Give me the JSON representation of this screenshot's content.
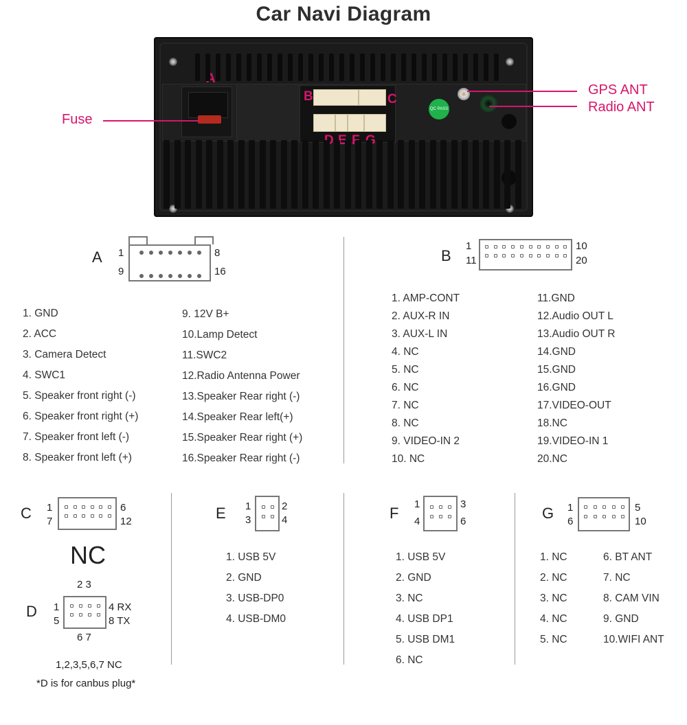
{
  "title": "Car Navi Diagram",
  "photo": {
    "connector_labels": [
      "A",
      "B",
      "C",
      "D",
      "E",
      "F",
      "G"
    ],
    "callouts": {
      "fuse": "Fuse",
      "gps_ant": "GPS ANT",
      "radio_ant": "Radio ANT"
    },
    "sticker": "QC PASS",
    "accent_color": "#d6156b"
  },
  "connector_a": {
    "letter": "A",
    "pin_labels": {
      "top_left": "1",
      "top_right": "8",
      "bottom_left": "9",
      "bottom_right": "16"
    },
    "pins_left": [
      "1. GND",
      "2. ACC",
      "3. Camera Detect",
      "4. SWC1",
      "5. Speaker front right (-)",
      "6. Speaker front right (+)",
      "7. Speaker front left (-)",
      "8. Speaker front left (+)"
    ],
    "pins_right": [
      "9.  12V B+",
      "10.Lamp Detect",
      "11.SWC2",
      "12.Radio Antenna Power",
      "13.Speaker Rear right (-)",
      "14.Speaker Rear left(+)",
      "15.Speaker Rear right (+)",
      "16.Speaker Rear right (-)"
    ]
  },
  "connector_b": {
    "letter": "B",
    "pin_labels": {
      "top_left": "1",
      "top_right": "10",
      "bottom_left": "11",
      "bottom_right": "20"
    },
    "pins_left": [
      "1.  AMP-CONT",
      "2.  AUX-R IN",
      "3.  AUX-L IN",
      "4.  NC",
      "5.  NC",
      "6.  NC",
      "7.  NC",
      "8.  NC",
      "9. VIDEO-IN 2",
      "10.  NC"
    ],
    "pins_right": [
      "11.GND",
      "12.Audio OUT  L",
      "13.Audio OUT  R",
      "14.GND",
      "15.GND",
      "16.GND",
      "17.VIDEO-OUT",
      "18.NC",
      "19.VIDEO-IN 1",
      "20.NC"
    ]
  },
  "connector_c": {
    "letter": "C",
    "pin_labels": {
      "top_left": "1",
      "top_right": "6",
      "bottom_left": "7",
      "bottom_right": "12"
    },
    "status": "NC"
  },
  "connector_d": {
    "letter": "D",
    "pin_labels": {
      "top": "2 3",
      "top_left": "1",
      "top_right": "4  RX",
      "bottom_left": "5",
      "bottom_right": "8  TX",
      "bottom": "6 7"
    },
    "nc_note": "1,2,3,5,6,7  NC",
    "footnote": "*D is for canbus plug*"
  },
  "connector_e": {
    "letter": "E",
    "pin_labels": {
      "top_left": "1",
      "top_right": "2",
      "bottom_left": "3",
      "bottom_right": "4"
    },
    "pins": [
      "1. USB 5V",
      "2. GND",
      "3. USB-DP0",
      "4. USB-DM0"
    ]
  },
  "connector_f": {
    "letter": "F",
    "pin_labels": {
      "top_left": "1",
      "top_right": "3",
      "bottom_left": "4",
      "bottom_right": "6"
    },
    "pins": [
      "1. USB 5V",
      "2. GND",
      "3. NC",
      "4. USB DP1",
      "5. USB DM1",
      "6. NC"
    ]
  },
  "connector_g": {
    "letter": "G",
    "pin_labels": {
      "top_left": "1",
      "top_right": "5",
      "bottom_left": "6",
      "bottom_right": "10"
    },
    "pins_left": [
      "1. NC",
      "2. NC",
      "3. NC",
      "4. NC",
      "5. NC"
    ],
    "pins_right": [
      "6.  BT ANT",
      "7.  NC",
      "8.  CAM VIN",
      "9.  GND",
      "10.WIFI ANT"
    ]
  }
}
